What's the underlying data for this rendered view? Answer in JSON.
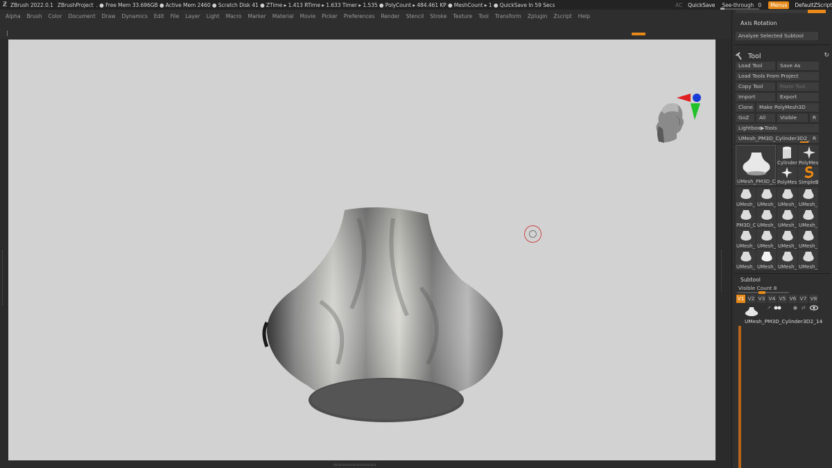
{
  "titlebar": {
    "app": "ZBrush 2022.0.1",
    "project": "ZBrushProject",
    "stats": ". ● Free Mem 33.696GB ● Active Mem 2460 ● Scratch Disk 41 ● ZTime ▸ 1.413 RTime ▸ 1.633 Timer ▸ 1.535 ● PolyCount ▸ 484.461 KP ● MeshCount ▸ 1 ● QuickSave In 59 Secs",
    "ac": "AC",
    "quicksave": "QuickSave",
    "seethrough": "See-through",
    "seethrough_value": "0",
    "menus": "Menus",
    "default_zscript": "DefaultZScript"
  },
  "menubar": [
    "Alpha",
    "Brush",
    "Color",
    "Document",
    "Draw",
    "Dynamics",
    "Edit",
    "File",
    "Layer",
    "Light",
    "Macro",
    "Marker",
    "Material",
    "Movie",
    "Picker",
    "Preferences",
    "Render",
    "Stencil",
    "Stroke",
    "Texture",
    "Tool",
    "Transform",
    "Zplugin",
    "Zscript",
    "Help"
  ],
  "panel": {
    "axis_rotation": "Axis Rotation",
    "analyze_subtool": "Analyze Selected Subtool",
    "tool_title": "Tool",
    "buttons": {
      "load_tool": "Load Tool",
      "save_as": "Save As",
      "load_tools_from_project": "Load Tools From Project",
      "copy_tool": "Copy Tool",
      "paste_tool": "Paste Tool",
      "import": "Import",
      "export": "Export",
      "clone": "Clone",
      "make_polymesh": "Make PolyMesh3D",
      "goz": "GoZ",
      "all": "All",
      "visible": "Visible",
      "r": "R",
      "lightbox_tools": "Lightbox▶Tools"
    },
    "current_tool": "UMesh_PM3D_Cylinder3D2_1",
    "current_tool_r": "R",
    "tool_thumbs": {
      "main": "UMesh_PM3D_C",
      "cylinder": "Cylinder",
      "polymesh": "PolyMes",
      "polymesh2": "PolyMes",
      "simpleb": "SimpleB"
    },
    "grid_labels": [
      "UMesh_",
      "UMesh_",
      "UMesh_",
      "UMesh_",
      "PM3D_C",
      "UMesh_",
      "UMesh_",
      "UMesh_",
      "UMesh_",
      "UMesh_",
      "UMesh_",
      "UMesh_",
      "UMesh_",
      "UMesh_",
      "UMesh_",
      "UMesh_"
    ],
    "subtool_title": "Subtool",
    "visible_count": "Visible Count 8",
    "visibility_tabs": [
      "V1",
      "V2",
      "V3",
      "V4",
      "V5",
      "V6",
      "V7",
      "V8"
    ],
    "subtool_name": "UMesh_PM3D_Cylinder3D2_14"
  },
  "colors": {
    "accent": "#e88a1a",
    "viewport_bg": "#d2d2d2",
    "panel_bg": "#2f2f2f"
  }
}
